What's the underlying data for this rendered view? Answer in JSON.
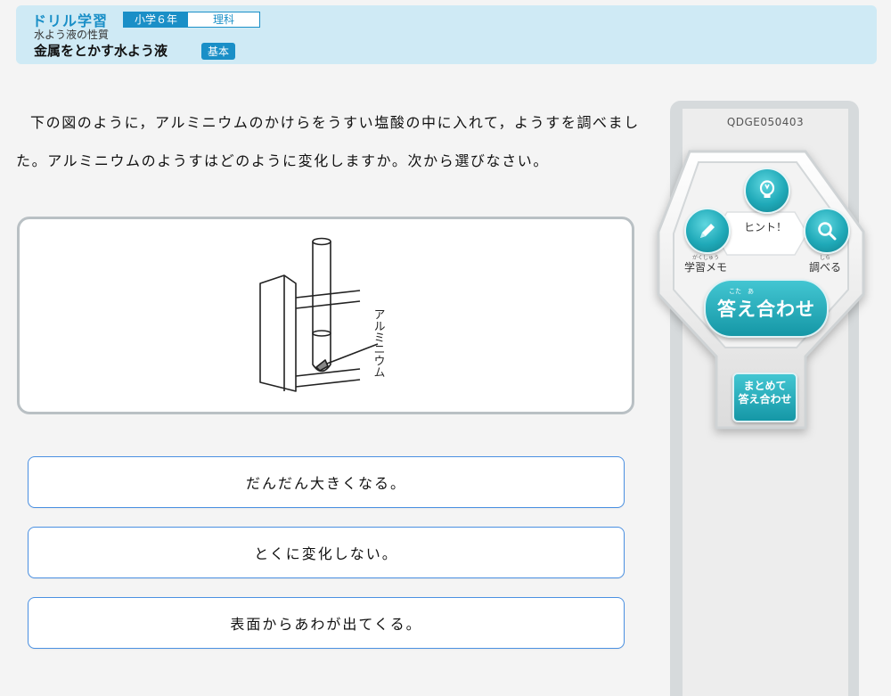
{
  "header": {
    "brand": "ドリル学習",
    "grade": "小学６年",
    "subject": "理科",
    "unit": "水よう液の性質",
    "lesson_title": "金属をとかす水よう液",
    "level": "基本"
  },
  "question": {
    "text": "下の図のように，アルミニウムのかけらをうすい塩酸の中に入れて，ようすを調べました。アルミニウムのようすはどのように変化しますか。次から選びなさい。"
  },
  "figure": {
    "label": "アルミニウム"
  },
  "choices": [
    {
      "label": "だんだん大きくなる。"
    },
    {
      "label": "とくに変化しない。"
    },
    {
      "label": "表面からあわが出てくる。"
    }
  ],
  "panel": {
    "question_id": "QDGE050403",
    "hint_label": "ヒント！",
    "memo_label": "学習メモ",
    "memo_ruby": "がくしゅう",
    "lookup_label": "調べる",
    "lookup_ruby": "しら",
    "answer_label": "答え合わせ",
    "answer_ruby": "こた　あ",
    "all_answer_line1": "まとめて",
    "all_answer_line2": "答え合わせ"
  },
  "colors": {
    "accent": "#1a8fc7",
    "teal": "#1fa9b8",
    "choice_border": "#4a90e2"
  }
}
